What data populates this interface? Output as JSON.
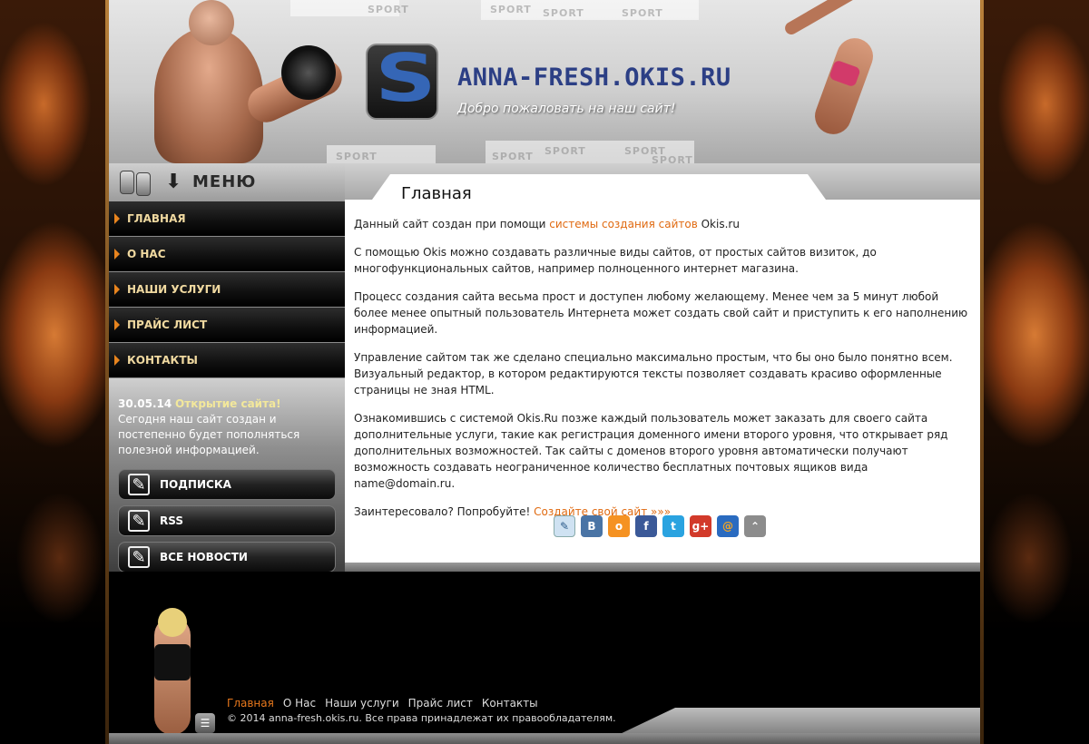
{
  "header": {
    "site_title": "ANNA-FRESH.OKIS.RU",
    "slogan": "Добро пожаловать на наш сайт!",
    "sport_words": [
      "SPORT",
      "SPORT",
      "SPORT",
      "SPORT",
      "SPORT",
      "SPORT",
      "SPORT",
      "SPORT",
      "SPORT"
    ]
  },
  "menu_header": {
    "label": "МЕНЮ"
  },
  "nav": {
    "items": [
      {
        "label": "ГЛАВНАЯ"
      },
      {
        "label": "О НАС"
      },
      {
        "label": "НАШИ УСЛУГИ"
      },
      {
        "label": "ПРАЙС ЛИСТ"
      },
      {
        "label": "КОНТАКТЫ"
      }
    ]
  },
  "news": {
    "date": "30.05.14",
    "title": "Открытие сайта!",
    "text": "Сегодня наш сайт создан и постепенно будет пополняться полезной информацией."
  },
  "side_buttons": [
    {
      "label": "ПОДПИСКА",
      "icon": "edit-icon"
    },
    {
      "label": "RSS",
      "icon": "edit-icon"
    },
    {
      "label": "ВСЕ НОВОСТИ",
      "icon": "edit-icon"
    }
  ],
  "page": {
    "title": "Главная",
    "p1_before": "Данный сайт создан при помощи ",
    "p1_link": "системы создания сайтов",
    "p1_after": " Okis.ru",
    "p2": "С помощью Okis можно создавать различные виды сайтов, от простых сайтов визиток, до многофункциональных сайтов, например полноценного интернет магазина.",
    "p3": "Процесс создания сайта весьма прост и доступен любому желающему. Менее чем за 5 минут любой более менее опытный пользователь Интернета может создать свой сайт и приступить к его наполнению информацией.",
    "p4": "Управление сайтом так же сделано специально максимально простым, что бы оно было понятно всем. Визуальный редактор, в котором редактируются тексты позволяет создавать красиво оформленные страницы не зная HTML.",
    "p5": "Ознакомившись с системой Okis.Ru позже каждый пользователь может заказать для своего сайта дополнительные услуги, такие как регистрация доменного имени второго уровня, что открывает ряд дополнительных возможностей. Так сайты с доменов второго уровня автоматически получают возможность создавать неограниченное количество бесплатных почтовых ящиков вида name@domain.ru.",
    "p6_before": "Заинтересовало? Попробуйте! ",
    "p6_link": "Создайте свой сайт »»»"
  },
  "share": [
    {
      "icon": "livejournal-icon",
      "glyph": "✎",
      "color": "#cfe2f2"
    },
    {
      "icon": "vkontakte-icon",
      "glyph": "В",
      "color": "#4a74a5"
    },
    {
      "icon": "odnoklassniki-icon",
      "glyph": "о",
      "color": "#f59222"
    },
    {
      "icon": "facebook-icon",
      "glyph": "f",
      "color": "#3b5998"
    },
    {
      "icon": "twitter-icon",
      "glyph": "t",
      "color": "#2aa3e0"
    },
    {
      "icon": "google-plus-icon",
      "glyph": "g+",
      "color": "#d23a2a"
    },
    {
      "icon": "mailru-icon",
      "glyph": "@",
      "color": "#2a6bc0"
    },
    {
      "icon": "bookmark-icon",
      "glyph": "⌃",
      "color": "#8c8c8c"
    }
  ],
  "footer": {
    "links": [
      {
        "label": "Главная",
        "active": true
      },
      {
        "label": "О Нас",
        "active": false
      },
      {
        "label": "Наши услуги",
        "active": false
      },
      {
        "label": "Прайс лист",
        "active": false
      },
      {
        "label": "Контакты",
        "active": false
      }
    ],
    "copyright": "© 2014 anna-fresh.okis.ru. Все права принадлежат их правообладателям."
  },
  "colors": {
    "accent_orange": "#e06a11",
    "nav_text": "#f0d9a0",
    "title_blue": "#2c3f85"
  }
}
